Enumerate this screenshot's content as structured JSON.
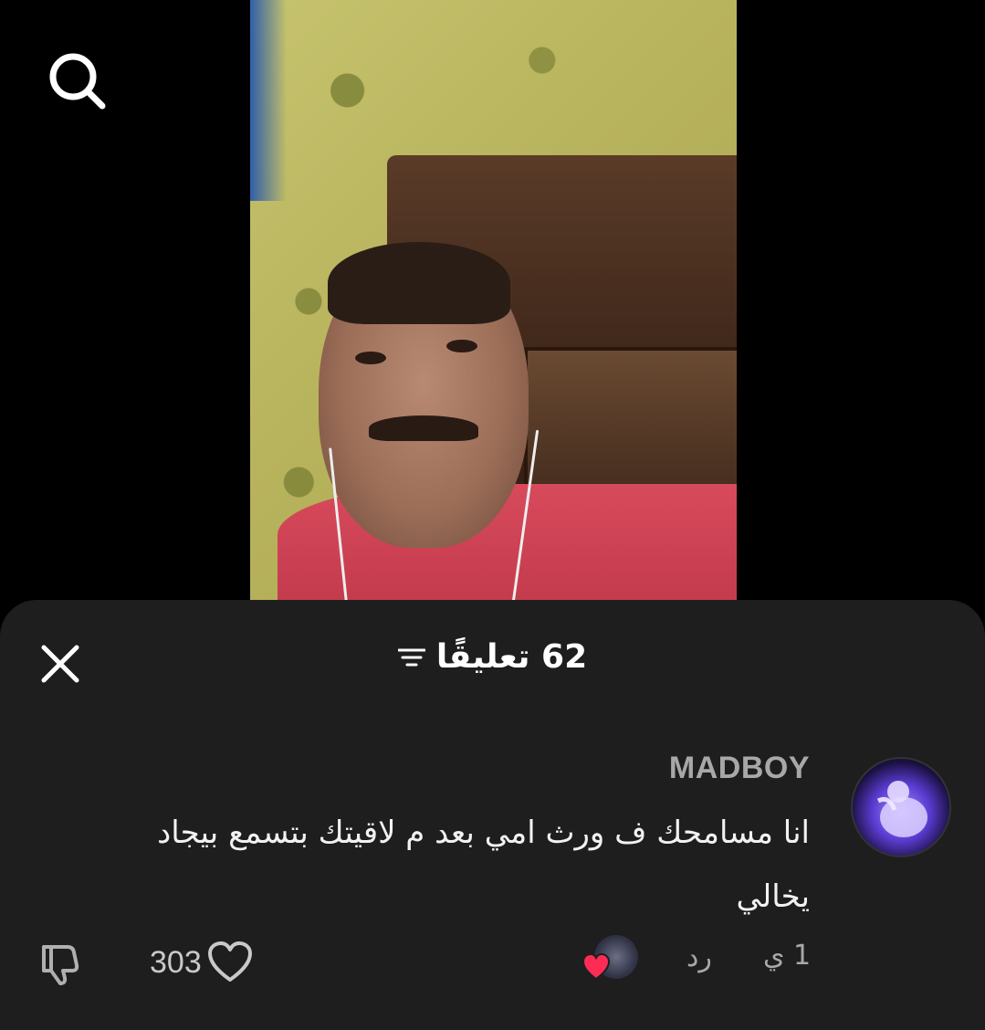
{
  "top_bar": {
    "search_icon": "search-icon"
  },
  "comments_sheet": {
    "close_icon": "close-icon",
    "filter_icon": "filter-icon",
    "title": "62 تعليقًا"
  },
  "comment": {
    "username": "MADBOY",
    "text_line1": "انا مسامحك ف ورث امي بعد م لاقيتك بتسمع بيجاد",
    "text_line2": "يخالي",
    "timestamp": "1 ي",
    "reply_label": "رد",
    "like_count": "303",
    "heart_icon": "heart-icon",
    "dislike_icon": "thumbs-down-icon",
    "creator_liked_icon": "creator-heart-icon",
    "creator_liked_color": "#fe2c55"
  }
}
